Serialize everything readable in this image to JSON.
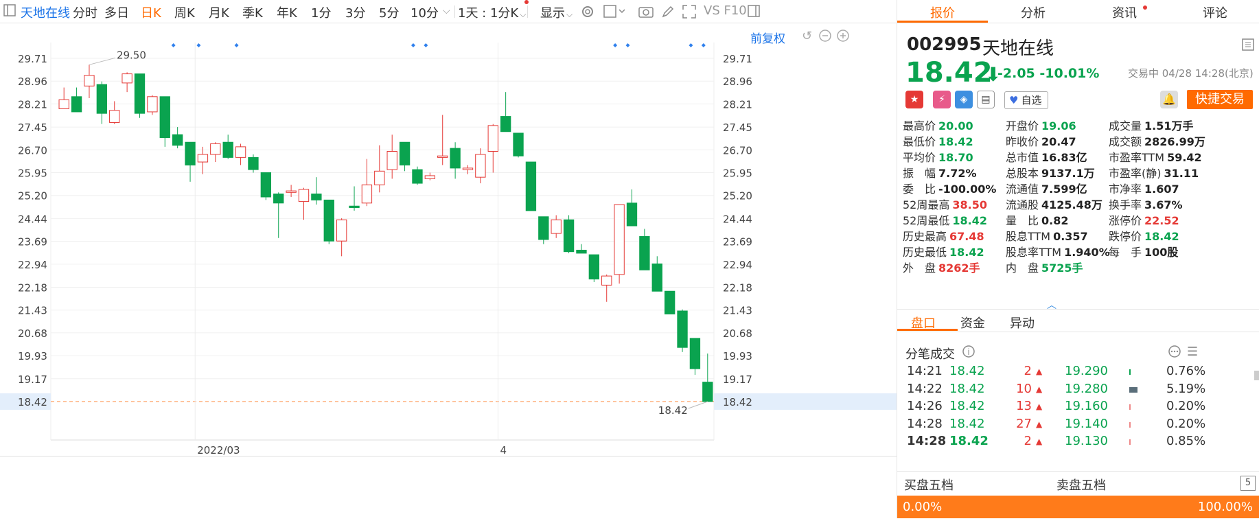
{
  "toolbar": {
    "stock_name": "天地在线",
    "items": [
      "分时",
      "多日",
      "日K",
      "周K",
      "月K",
      "季K",
      "年K",
      "1分",
      "3分",
      "5分",
      "10分"
    ],
    "active_item": "日K",
    "period_dropdown": "1天 : 1分K",
    "display_dropdown": "显示",
    "f10": "VS F10"
  },
  "chart": {
    "adjust_label": "前复权",
    "y_ticks": [
      "29.71",
      "28.96",
      "28.21",
      "27.45",
      "26.70",
      "25.95",
      "25.20",
      "24.44",
      "23.69",
      "22.94",
      "22.18",
      "21.43",
      "20.68",
      "19.93",
      "19.17",
      "18.42"
    ],
    "x_labels": [
      "2022/03",
      "4"
    ],
    "high_annotation": "29.50",
    "low_annotation": "18.42",
    "current_price_label": "18.42",
    "up_color": "#e53935",
    "down_color": "#0aa34f"
  },
  "chart_data": {
    "type": "candlestick",
    "ylim": [
      18.42,
      29.71
    ],
    "x_ticks": [
      "2022/03",
      "4"
    ],
    "candles": [
      {
        "o": 28.05,
        "h": 28.75,
        "l": 28.05,
        "c": 28.35
      },
      {
        "o": 28.45,
        "h": 28.75,
        "l": 27.95,
        "c": 27.95
      },
      {
        "o": 28.8,
        "h": 29.5,
        "l": 28.4,
        "c": 29.15
      },
      {
        "o": 28.85,
        "h": 28.95,
        "l": 27.55,
        "c": 27.9
      },
      {
        "o": 27.6,
        "h": 28.3,
        "l": 27.55,
        "c": 28.0
      },
      {
        "o": 28.9,
        "h": 29.25,
        "l": 28.6,
        "c": 29.2
      },
      {
        "o": 29.2,
        "h": 29.2,
        "l": 27.75,
        "c": 27.9
      },
      {
        "o": 27.95,
        "h": 28.5,
        "l": 27.85,
        "c": 28.45
      },
      {
        "o": 28.45,
        "h": 28.45,
        "l": 26.8,
        "c": 27.1
      },
      {
        "o": 27.2,
        "h": 27.45,
        "l": 26.75,
        "c": 26.85
      },
      {
        "o": 26.95,
        "h": 26.95,
        "l": 25.65,
        "c": 26.2
      },
      {
        "o": 26.3,
        "h": 26.8,
        "l": 25.9,
        "c": 26.55
      },
      {
        "o": 26.55,
        "h": 26.95,
        "l": 26.3,
        "c": 26.9
      },
      {
        "o": 26.95,
        "h": 27.2,
        "l": 26.4,
        "c": 26.45
      },
      {
        "o": 26.45,
        "h": 26.9,
        "l": 26.2,
        "c": 26.8
      },
      {
        "o": 26.45,
        "h": 26.55,
        "l": 25.95,
        "c": 26.05
      },
      {
        "o": 25.95,
        "h": 25.95,
        "l": 25.05,
        "c": 25.15
      },
      {
        "o": 25.25,
        "h": 25.3,
        "l": 23.8,
        "c": 24.95
      },
      {
        "o": 25.3,
        "h": 25.55,
        "l": 25.15,
        "c": 25.35
      },
      {
        "o": 25.0,
        "h": 25.45,
        "l": 24.4,
        "c": 25.4
      },
      {
        "o": 25.25,
        "h": 25.8,
        "l": 24.9,
        "c": 25.05
      },
      {
        "o": 25.05,
        "h": 25.05,
        "l": 23.6,
        "c": 23.7
      },
      {
        "o": 23.7,
        "h": 24.45,
        "l": 23.2,
        "c": 24.4
      },
      {
        "o": 24.85,
        "h": 25.5,
        "l": 24.7,
        "c": 24.8
      },
      {
        "o": 24.95,
        "h": 26.4,
        "l": 24.85,
        "c": 25.55
      },
      {
        "o": 25.55,
        "h": 26.85,
        "l": 25.3,
        "c": 26.0
      },
      {
        "o": 26.05,
        "h": 27.2,
        "l": 25.75,
        "c": 26.65
      },
      {
        "o": 26.95,
        "h": 26.95,
        "l": 26.0,
        "c": 26.2
      },
      {
        "o": 26.05,
        "h": 26.15,
        "l": 25.55,
        "c": 25.6
      },
      {
        "o": 25.75,
        "h": 25.95,
        "l": 25.7,
        "c": 25.85
      },
      {
        "o": 26.45,
        "h": 27.85,
        "l": 26.2,
        "c": 26.5
      },
      {
        "o": 26.75,
        "h": 26.95,
        "l": 25.75,
        "c": 26.1
      },
      {
        "o": 26.05,
        "h": 26.2,
        "l": 25.9,
        "c": 26.1
      },
      {
        "o": 25.8,
        "h": 26.75,
        "l": 25.6,
        "c": 26.55
      },
      {
        "o": 26.65,
        "h": 27.55,
        "l": 25.95,
        "c": 27.5
      },
      {
        "o": 27.8,
        "h": 28.6,
        "l": 27.3,
        "c": 27.3
      },
      {
        "o": 27.25,
        "h": 27.25,
        "l": 26.45,
        "c": 26.5
      },
      {
        "o": 26.3,
        "h": 26.3,
        "l": 24.7,
        "c": 24.7
      },
      {
        "o": 24.5,
        "h": 24.5,
        "l": 23.6,
        "c": 23.75
      },
      {
        "o": 23.95,
        "h": 24.55,
        "l": 23.8,
        "c": 24.4
      },
      {
        "o": 24.4,
        "h": 24.55,
        "l": 23.3,
        "c": 23.35
      },
      {
        "o": 23.4,
        "h": 23.6,
        "l": 23.3,
        "c": 23.3
      },
      {
        "o": 23.25,
        "h": 23.25,
        "l": 22.35,
        "c": 22.45
      },
      {
        "o": 22.25,
        "h": 22.6,
        "l": 21.7,
        "c": 22.55
      },
      {
        "o": 22.6,
        "h": 24.9,
        "l": 22.3,
        "c": 24.9
      },
      {
        "o": 24.95,
        "h": 25.4,
        "l": 24.2,
        "c": 24.2
      },
      {
        "o": 23.85,
        "h": 24.1,
        "l": 22.75,
        "c": 22.75
      },
      {
        "o": 22.95,
        "h": 23.2,
        "l": 22.05,
        "c": 22.05
      },
      {
        "o": 22.05,
        "h": 22.05,
        "l": 21.3,
        "c": 21.3
      },
      {
        "o": 21.4,
        "h": 21.45,
        "l": 20.05,
        "c": 20.2
      },
      {
        "o": 20.5,
        "h": 20.5,
        "l": 19.3,
        "c": 19.5
      },
      {
        "o": 19.06,
        "h": 20.0,
        "l": 18.42,
        "c": 18.42
      }
    ]
  },
  "quote": {
    "code": "002995",
    "name": "天地在线",
    "price": "18.42",
    "change": "-2.05",
    "change_pct": "-10.01%",
    "status": "交易中 04/28 14:28(北京)",
    "watch_label": "自选",
    "trade_button": "快捷交易"
  },
  "tabs": [
    "报价",
    "分析",
    "资讯",
    "评论"
  ],
  "stats": [
    [
      {
        "l": "最高价",
        "v": "20.00",
        "c": "g"
      },
      {
        "l": "开盘价",
        "v": "19.06",
        "c": "g"
      },
      {
        "l": "成交量",
        "v": "1.51万手",
        "c": "k"
      }
    ],
    [
      {
        "l": "最低价",
        "v": "18.42",
        "c": "g"
      },
      {
        "l": "昨收价",
        "v": "20.47",
        "c": "k"
      },
      {
        "l": "成交额",
        "v": "2826.99万",
        "c": "k"
      }
    ],
    [
      {
        "l": "平均价",
        "v": "18.70",
        "c": "g"
      },
      {
        "l": "总市值",
        "v": "16.83亿",
        "c": "k"
      },
      {
        "l": "市盈率TTM",
        "v": "59.42",
        "c": "k"
      }
    ],
    [
      {
        "l": "振　幅",
        "v": "7.72%",
        "c": "k"
      },
      {
        "l": "总股本",
        "v": "9137.1万",
        "c": "k"
      },
      {
        "l": "市盈率(静)",
        "v": "31.11",
        "c": "k"
      }
    ],
    [
      {
        "l": "委　比",
        "v": "-100.00%",
        "c": "k"
      },
      {
        "l": "流通值",
        "v": "7.599亿",
        "c": "k"
      },
      {
        "l": "市净率",
        "v": "1.607",
        "c": "k"
      }
    ],
    [
      {
        "l": "52周最高",
        "v": "38.50",
        "c": "r"
      },
      {
        "l": "流通股",
        "v": "4125.48万",
        "c": "k"
      },
      {
        "l": "换手率",
        "v": "3.67%",
        "c": "k"
      }
    ],
    [
      {
        "l": "52周最低",
        "v": "18.42",
        "c": "g"
      },
      {
        "l": "量　比",
        "v": "0.82",
        "c": "k"
      },
      {
        "l": "涨停价",
        "v": "22.52",
        "c": "r"
      }
    ],
    [
      {
        "l": "历史最高",
        "v": "67.48",
        "c": "r"
      },
      {
        "l": "股息TTM",
        "v": "0.357",
        "c": "k"
      },
      {
        "l": "跌停价",
        "v": "18.42",
        "c": "g"
      }
    ],
    [
      {
        "l": "历史最低",
        "v": "18.42",
        "c": "g"
      },
      {
        "l": "股息率TTM",
        "v": "1.940%",
        "c": "k"
      },
      {
        "l": "每　手",
        "v": "100股",
        "c": "k"
      }
    ],
    [
      {
        "l": "外　盘",
        "v": "8262手",
        "c": "r"
      },
      {
        "l": "内　盘",
        "v": "5725手",
        "c": "g"
      },
      {
        "l": "",
        "v": "",
        "c": "k"
      }
    ]
  ],
  "subtabs": [
    "盘口",
    "资金",
    "异动"
  ],
  "trades_title": "分笔成交",
  "trades": [
    {
      "time": "14:21",
      "price": "18.42",
      "vol": "2",
      "ask": "19.290",
      "pct": "0.76%"
    },
    {
      "time": "14:22",
      "price": "18.42",
      "vol": "10",
      "ask": "19.280",
      "pct": "5.19%"
    },
    {
      "time": "14:26",
      "price": "18.42",
      "vol": "13",
      "ask": "19.160",
      "pct": "0.20%"
    },
    {
      "time": "14:28",
      "price": "18.42",
      "vol": "27",
      "ask": "19.140",
      "pct": "0.20%"
    },
    {
      "time": "14:28",
      "price": "18.42",
      "vol": "2",
      "ask": "19.130",
      "pct": "0.85%"
    }
  ],
  "bid_title": "买盘五档",
  "ask_title": "卖盘五档",
  "bar_left": "0.00%",
  "bar_right": "100.00%"
}
